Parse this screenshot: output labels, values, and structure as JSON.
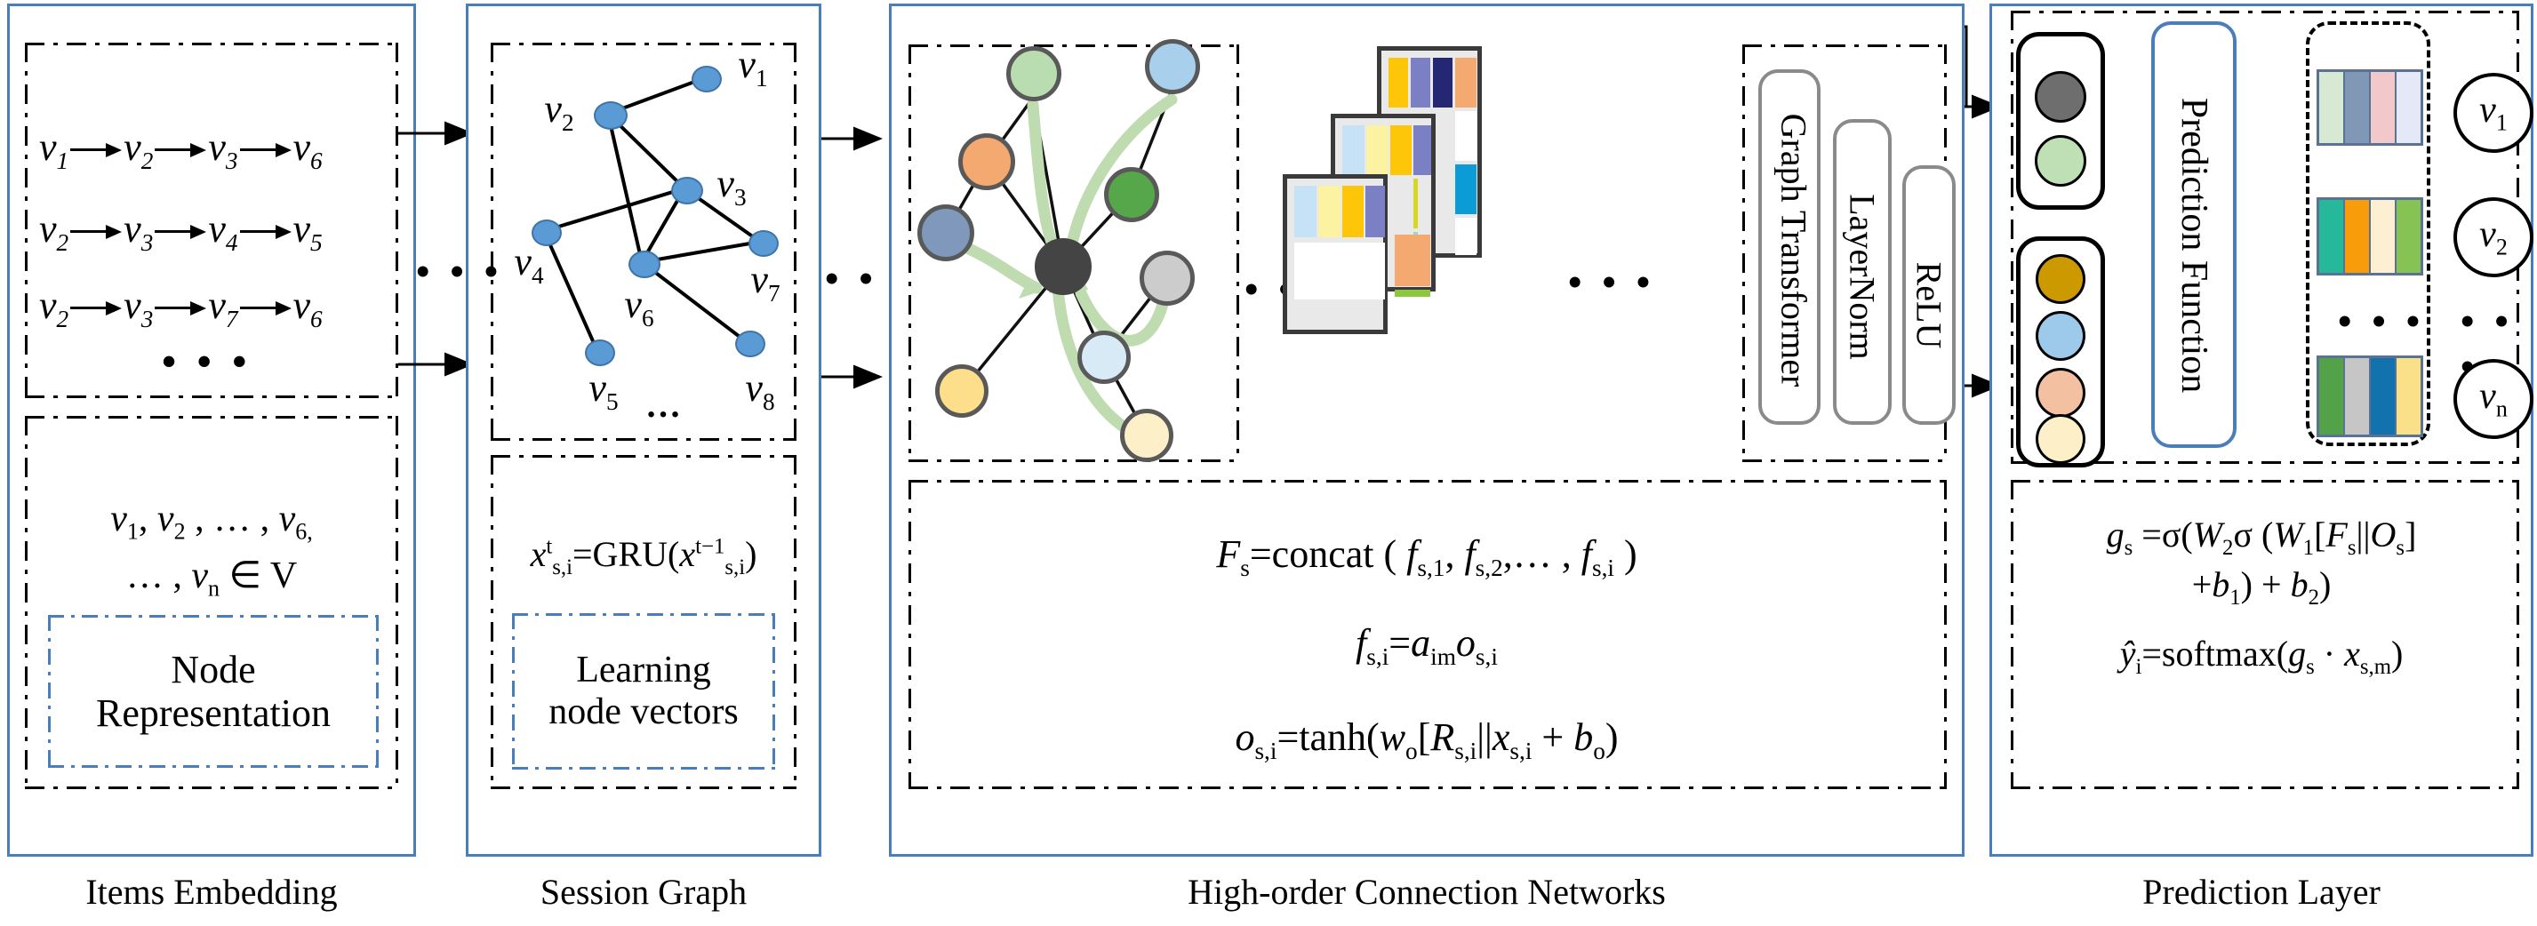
{
  "panels": [
    {
      "id": "items",
      "caption": "Items Embedding"
    },
    {
      "id": "session",
      "caption": "Session Graph"
    },
    {
      "id": "highorder",
      "caption": "High-order Connection Networks"
    },
    {
      "id": "prediction",
      "caption": "Prediction Layer"
    }
  ],
  "items_embedding": {
    "sequences": [
      [
        "v1",
        "v2",
        "v3",
        "v6"
      ],
      [
        "v2",
        "v3",
        "v4",
        "v5"
      ],
      [
        "v2",
        "v3",
        "v7",
        "v6"
      ]
    ],
    "ellipsis": "• • •",
    "node_set_line1": "v₁, v₂ , … , v₆,",
    "node_set_line2": "… , vₙ ∈ V",
    "sub_label_line1": "Node",
    "sub_label_line2": "Representation"
  },
  "session_graph": {
    "node_labels": [
      "v₁",
      "v₂",
      "v₃",
      "v₄",
      "v₅",
      "v₆",
      "v₇",
      "v₈"
    ],
    "graph_ellipsis": "…",
    "formula": "xₛ,ᵢᵗ = GRU( xₛ,ᵢᵗ⁻¹ )",
    "formula_parts": {
      "lhs": "x",
      "lhs_sup": "t",
      "lhs_sub": "s,i",
      "fn": "=GRU(",
      "arg": "x",
      "arg_sup": "t−1",
      "arg_sub": "s,i",
      "close": ")"
    },
    "sub_label_line1": "Learning",
    "sub_label_line2": "node vectors"
  },
  "high_order": {
    "graph_node_colors": [
      "#b9ddb0",
      "#a8cfec",
      "#f4a971",
      "#56a64a",
      "#7f98bb",
      "#444444",
      "#cccccc",
      "#fde7a9",
      "#d9eaf7",
      "#fdde8a",
      "#fdf0c8"
    ],
    "highlight_arrow_color": "#bedcb0",
    "ellipsis": "• • •",
    "blocks": [
      "Graph Transformer",
      "LayerNorm",
      "ReLU"
    ],
    "formulas": [
      "Fₛ=concat ( fₛ,₁, fₛ,₂,… , fₛ,ᵢ )",
      "fₛ,ᵢ=aᵢₘ oₛ,ᵢ",
      "oₛ,ᵢ=tanh(wₒ[Rₛ,ᵢ||xₛ,ᵢ + bₒ)"
    ]
  },
  "prediction": {
    "group_top_colors": [
      "#6e6e6e",
      "#bfe0b4"
    ],
    "group_bottom_colors": [
      "#cc9900",
      "#9dc9ea",
      "#f3c1a2",
      "#fdf0c8"
    ],
    "function_label": "Prediction Function",
    "output_rows": [
      {
        "label": "v₁",
        "colors": [
          "#d7e9d2",
          "#8097b5",
          "#f3c8cb",
          "#e5e9f7"
        ]
      },
      {
        "label": "v₂",
        "colors": [
          "#25b89a",
          "#f89c0c",
          "#fdf0d2",
          "#86c254"
        ]
      },
      {
        "label": "vₙ",
        "colors": [
          "#53a24a",
          "#c6c6c6",
          "#1272ad",
          "#fbe08a"
        ]
      }
    ],
    "vertical_ellipsis_vectors": "• • •",
    "vertical_ellipsis_labels": "• • •",
    "formulas": [
      "gₛ =σ(W₂σ (W₁[Fₛ||Oₛ]",
      "+b₁) + b₂)",
      "ŷᵢ=softmax(gₛ · xₛ,ₘ)"
    ]
  },
  "colors": {
    "panel_border": "#4a7ebb",
    "inner_border": "#000000",
    "accent_blue": "#5b9bd5",
    "green_arrow": "#bedcb0"
  }
}
